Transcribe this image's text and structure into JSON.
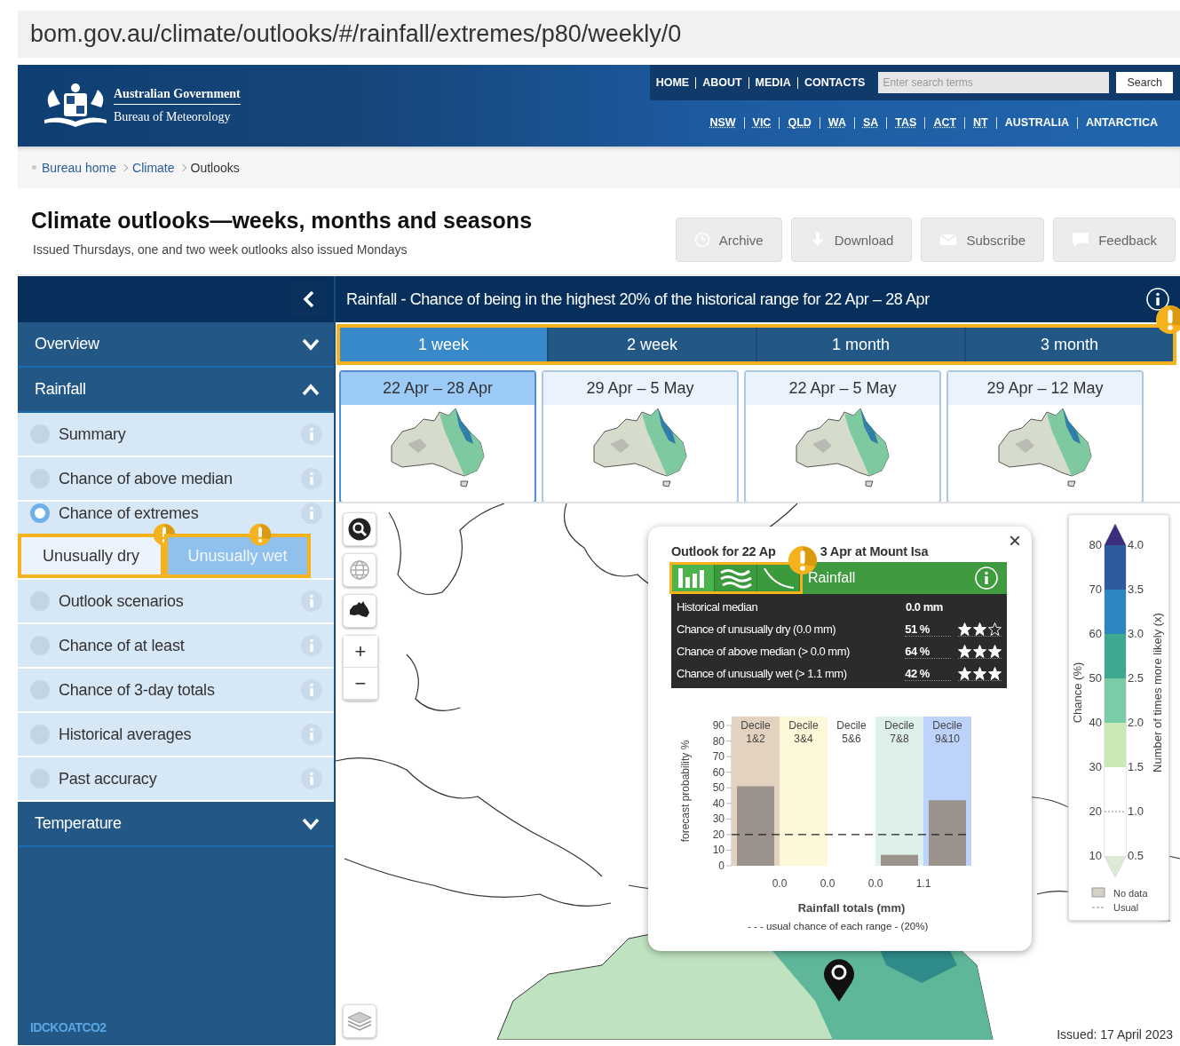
{
  "address_bar": {
    "url": "bom.gov.au/climate/outlooks/#/rainfall/extremes/p80/weekly/0"
  },
  "header": {
    "logo_lines": [
      "Australian Government",
      "Bureau of Meteorology"
    ],
    "top_links": [
      "HOME",
      "ABOUT",
      "MEDIA",
      "CONTACTS"
    ],
    "search": {
      "placeholder": "Enter search terms",
      "button": "Search"
    },
    "state_links": [
      {
        "label": "NSW",
        "underlined": true
      },
      {
        "label": "VIC",
        "underlined": true
      },
      {
        "label": "QLD",
        "underlined": true
      },
      {
        "label": "WA",
        "underlined": true
      },
      {
        "label": "SA",
        "underlined": true
      },
      {
        "label": "TAS",
        "underlined": true
      },
      {
        "label": "ACT",
        "underlined": true
      },
      {
        "label": "NT",
        "underlined": true
      },
      {
        "label": "AUSTRALIA",
        "underlined": false
      },
      {
        "label": "ANTARCTICA",
        "underlined": false
      }
    ]
  },
  "breadcrumb": [
    "Bureau home",
    "Climate",
    "Outlooks"
  ],
  "page": {
    "title": "Climate outlooks—weeks, months and seasons",
    "subtitle": "Issued Thursdays, one and two week outlooks also issued Mondays",
    "buttons": [
      {
        "label": "Archive"
      },
      {
        "label": "Download"
      },
      {
        "label": "Subscribe"
      },
      {
        "label": "Feedback"
      }
    ]
  },
  "sidebar": {
    "sections": [
      {
        "label": "Overview",
        "expanded": false
      },
      {
        "label": "Rainfall",
        "expanded": true,
        "items": [
          {
            "label": "Summary",
            "selected": false
          },
          {
            "label": "Chance of above median",
            "selected": false
          },
          {
            "label": "Chance of extremes",
            "selected": true,
            "options": [
              {
                "label": "Unusually dry",
                "selected": false
              },
              {
                "label": "Unusually wet",
                "selected": true
              }
            ]
          },
          {
            "label": "Outlook scenarios",
            "selected": false
          },
          {
            "label": "Chance of at least",
            "selected": false
          },
          {
            "label": "Chance of 3-day totals",
            "selected": false
          },
          {
            "label": "Historical averages",
            "selected": false
          },
          {
            "label": "Past accuracy",
            "selected": false
          }
        ]
      },
      {
        "label": "Temperature",
        "expanded": false
      }
    ],
    "product_code": "IDCKOATCO2"
  },
  "panel": {
    "title": "Rainfall - Chance of being in the highest 20% of the historical range for 22 Apr – 28 Apr",
    "tabs": [
      {
        "label": "1 week",
        "selected": true
      },
      {
        "label": "2 week",
        "selected": false
      },
      {
        "label": "1 month",
        "selected": false
      },
      {
        "label": "3 month",
        "selected": false
      }
    ],
    "thumbnails": [
      {
        "label": "22 Apr – 28 Apr",
        "selected": true
      },
      {
        "label": "29 Apr – 5 May",
        "selected": false
      },
      {
        "label": "22 Apr – 5 May",
        "selected": false
      },
      {
        "label": "29 Apr – 12 May",
        "selected": false
      }
    ]
  },
  "map": {
    "zoom_in": "+",
    "zoom_out": "−",
    "issued": "Issued: 17 April 2023"
  },
  "popup": {
    "close": "×",
    "title_parts": [
      "Outlook for 22 Ap",
      "3 Apr at Mount Isa"
    ],
    "views": [
      {
        "kind": "bars",
        "selected": true
      },
      {
        "kind": "waves",
        "selected": false
      },
      {
        "kind": "curve",
        "selected": false
      }
    ],
    "heading": "Rainfall",
    "rows": [
      {
        "label": "Historical median",
        "value": "0.0 mm"
      },
      {
        "label": "Chance of unusually dry (0.0 mm)",
        "value": "51 %",
        "stars": 2
      },
      {
        "label": "Chance of above median (> 0.0 mm)",
        "value": "64 %",
        "stars": 3
      },
      {
        "label": "Chance of unusually wet (> 1.1 mm)",
        "value": "42 %",
        "stars": 3
      }
    ],
    "chart_data": {
      "type": "bar",
      "xlabel": "Rainfall totals (mm)",
      "ylabel": "forecast probability %",
      "categories": [
        "Decile 1&2",
        "Decile 3&4",
        "Decile 5&6",
        "Decile 7&8",
        "Decile 9&10"
      ],
      "series": [
        {
          "color": "#9a928b",
          "values": [
            51,
            0,
            0,
            7,
            42
          ]
        }
      ],
      "ylim": [
        0,
        90
      ],
      "yticks": [
        0,
        10,
        20,
        30,
        40,
        50,
        60,
        70,
        80,
        90
      ],
      "ref_lines": [
        {
          "axis": "y",
          "value": 20,
          "label": "- - - usual chance of each range - (20%)"
        }
      ]
    },
    "boundary_labels": [
      "0.0",
      "0.0",
      "0.0",
      "1.1"
    ]
  },
  "legend": {
    "left_label": "Chance (%)",
    "right_label": "Number of times more likely (x)",
    "left_ticks": [
      "80",
      "70",
      "60",
      "50",
      "40",
      "30",
      "20",
      "10"
    ],
    "right_ticks": [
      "4.0",
      "3.5",
      "3.0",
      "2.5",
      "2.0",
      "1.5",
      "1.0",
      "0.5"
    ],
    "items": [
      "No data",
      "Usual"
    ]
  }
}
